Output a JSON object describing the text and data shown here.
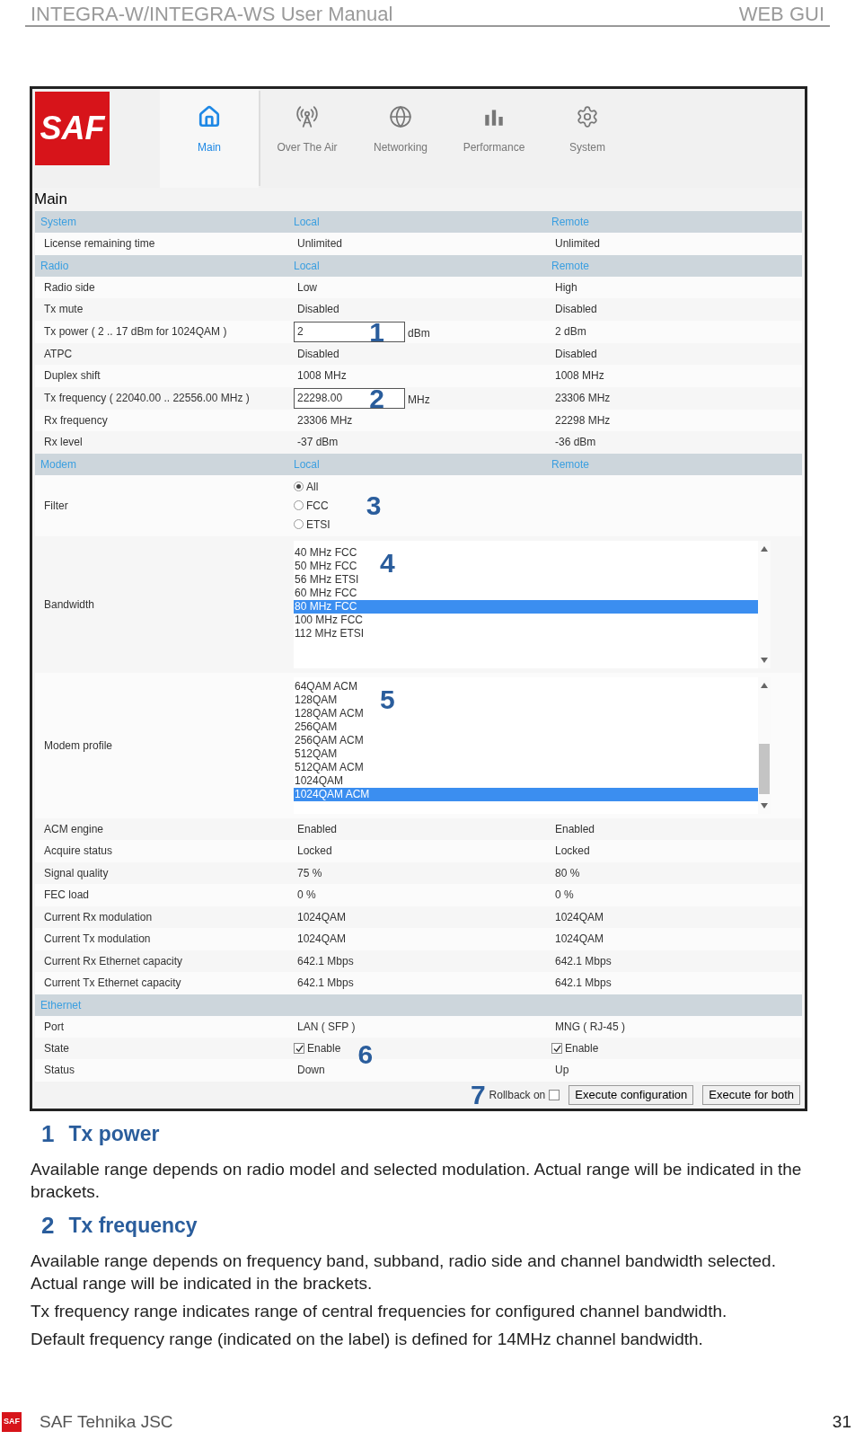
{
  "page_header": {
    "title": "INTEGRA-W/INTEGRA-WS User Manual",
    "section": "WEB GUI"
  },
  "app": {
    "logo": "SAF",
    "tabs": [
      {
        "label": "Main",
        "selected": true
      },
      {
        "label": "Over The Air",
        "selected": false
      },
      {
        "label": "Networking",
        "selected": false
      },
      {
        "label": "Performance",
        "selected": false
      },
      {
        "label": "System",
        "selected": false
      }
    ],
    "page_title": "Main",
    "sections": [
      {
        "name": "System",
        "local": "Local",
        "remote": "Remote",
        "rows": [
          {
            "kind": "text",
            "label": "License remaining time",
            "local": "Unlimited",
            "remote": "Unlimited"
          }
        ]
      },
      {
        "name": "Radio",
        "local": "Local",
        "remote": "Remote",
        "rows": [
          {
            "kind": "text",
            "label": "Radio side",
            "local": "Low",
            "remote": "High"
          },
          {
            "kind": "text",
            "label": "Tx mute",
            "local": "Disabled",
            "remote": "Disabled"
          },
          {
            "kind": "input",
            "label": "Tx power ( 2 .. 17  dBm  for  1024QAM )",
            "value": "2",
            "unit": "dBm",
            "callout": "1",
            "remote": "2 dBm"
          },
          {
            "kind": "text",
            "label": "ATPC",
            "local": "Disabled",
            "remote": "Disabled"
          },
          {
            "kind": "text",
            "label": "Duplex shift",
            "local": "1008 MHz",
            "remote": "1008 MHz"
          },
          {
            "kind": "input",
            "label": "Tx frequency ( 22040.00 .. 22556.00 MHz )",
            "value": "22298.00",
            "unit": "MHz",
            "callout": "2",
            "remote": "23306 MHz"
          },
          {
            "kind": "text",
            "label": "Rx frequency",
            "local": "23306 MHz",
            "remote": "22298 MHz"
          },
          {
            "kind": "text",
            "label": "Rx level",
            "local": "-37 dBm",
            "remote": "-36 dBm"
          }
        ]
      },
      {
        "name": "Modem",
        "local": "Local",
        "remote": "Remote",
        "rows": [
          {
            "kind": "radio",
            "label": "Filter",
            "callout": "3",
            "options": [
              {
                "label": "All",
                "selected": true
              },
              {
                "label": "FCC",
                "selected": false
              },
              {
                "label": "ETSI",
                "selected": false
              }
            ]
          },
          {
            "kind": "listbox",
            "label": "Bandwidth",
            "callout": "4",
            "scrolled": false,
            "items": [
              {
                "label": "40 MHz FCC",
                "selected": false
              },
              {
                "label": "50 MHz FCC",
                "selected": false
              },
              {
                "label": "56 MHz ETSI",
                "selected": false
              },
              {
                "label": "60 MHz FCC",
                "selected": false
              },
              {
                "label": "80 MHz FCC",
                "selected": true
              },
              {
                "label": "100 MHz FCC",
                "selected": false
              },
              {
                "label": "112 MHz ETSI",
                "selected": false
              }
            ]
          },
          {
            "kind": "listbox",
            "label": "Modem profile",
            "callout": "5",
            "scrolled": true,
            "items": [
              {
                "label": "64QAM ACM",
                "selected": false
              },
              {
                "label": "128QAM",
                "selected": false
              },
              {
                "label": "128QAM ACM",
                "selected": false
              },
              {
                "label": "256QAM",
                "selected": false
              },
              {
                "label": "256QAM ACM",
                "selected": false
              },
              {
                "label": "512QAM",
                "selected": false
              },
              {
                "label": "512QAM ACM",
                "selected": false
              },
              {
                "label": "1024QAM",
                "selected": false
              },
              {
                "label": "1024QAM ACM",
                "selected": true
              }
            ]
          },
          {
            "kind": "text",
            "label": "ACM engine",
            "local": "Enabled",
            "remote": "Enabled"
          },
          {
            "kind": "text",
            "label": "Acquire status",
            "local": "Locked",
            "remote": "Locked"
          },
          {
            "kind": "text",
            "label": "Signal quality",
            "local": "75 %",
            "remote": "80 %"
          },
          {
            "kind": "text",
            "label": "FEC load",
            "local": "0 %",
            "remote": "0 %"
          },
          {
            "kind": "text",
            "label": "Current Rx modulation",
            "local": "1024QAM",
            "remote": "1024QAM"
          },
          {
            "kind": "text",
            "label": "Current Tx modulation",
            "local": "1024QAM",
            "remote": "1024QAM"
          },
          {
            "kind": "text",
            "label": "Current Rx Ethernet capacity",
            "local": "642.1 Mbps",
            "remote": "642.1 Mbps"
          },
          {
            "kind": "text",
            "label": "Current Tx Ethernet capacity",
            "local": "642.1 Mbps",
            "remote": "642.1 Mbps"
          }
        ]
      },
      {
        "name": "Ethernet",
        "rows": [
          {
            "kind": "text",
            "label": "Port",
            "local": "LAN ( SFP )",
            "remote": "MNG ( RJ-45 )"
          },
          {
            "kind": "checkbox",
            "label": "State",
            "local": {
              "label": "Enable",
              "checked": true
            },
            "remote": {
              "label": "Enable",
              "checked": true
            },
            "callout": "6"
          },
          {
            "kind": "text",
            "label": "Status",
            "local": "Down",
            "remote": "Up"
          }
        ]
      }
    ],
    "footer_bar": {
      "callout": "7",
      "rollback": {
        "label": "Rollback on",
        "checked": false
      },
      "buttons": [
        "Execute configuration",
        "Execute for both"
      ]
    }
  },
  "notes": [
    {
      "number": "1",
      "title": "Tx power",
      "paragraphs": [
        "Available range depends on radio model and selected modulation. Actual range will be indicated in the brackets."
      ]
    },
    {
      "number": "2",
      "title": "Tx frequency",
      "paragraphs": [
        "Available range depends on frequency band, subband, radio side and channel bandwidth selected. Actual range will be indicated in the brackets.",
        "Tx frequency range indicates range of central frequencies for configured channel bandwidth.",
        "Default frequency range (indicated on the label) is defined for 14MHz channel bandwidth."
      ]
    }
  ],
  "page_footer": {
    "logo": "SAF",
    "company": "SAF Tehnika JSC",
    "page": "31"
  }
}
